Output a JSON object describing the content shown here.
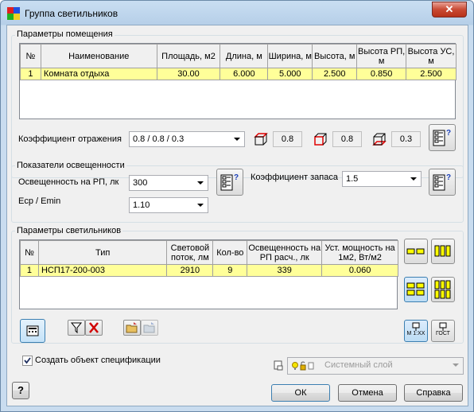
{
  "window": {
    "title": "Группа светильников",
    "close_label": "✕"
  },
  "room_params": {
    "group_label": "Параметры помещения",
    "headers": [
      "№",
      "Наименование",
      "Площадь, м2",
      "Длина, м",
      "Ширина, м",
      "Высота, м",
      "Высота РП, м",
      "Высота УС, м"
    ],
    "rows": [
      [
        "1",
        "Комната отдыха",
        "30.00",
        "6.000",
        "5.000",
        "2.500",
        "0.850",
        "2.500"
      ]
    ],
    "reflection_label": "Коэффициент отражения",
    "reflection_value": "0.8 / 0.8 / 0.3",
    "ceiling_value": "0.8",
    "walls_value": "0.8",
    "floor_value": "0.3"
  },
  "lighting": {
    "group_label": "Показатели освещенности",
    "illuminance_label": "Освещенность на РП, лк",
    "illuminance_value": "300",
    "ecp_label": "Eср / Emin",
    "ecp_value": "1.10",
    "reserve_label": "Коэффициент запаса",
    "reserve_value": "1.5"
  },
  "fixtures": {
    "group_label": "Параметры светильников",
    "headers": [
      "№",
      "Тип",
      "Световой поток, лм",
      "Кол-во",
      "Освещенность на РП расч., лк",
      "Уст. мощность на 1м2, Вт/м2"
    ],
    "rows": [
      [
        "1",
        "НСП17-200-003",
        "2910",
        "9",
        "339",
        "0.060"
      ]
    ],
    "scale_label": "М 1:XX",
    "gost_label": "ГОСТ"
  },
  "footer": {
    "create_spec_label": "Создать объект спецификации",
    "create_spec_checked": true,
    "layer_value": "Системный слой",
    "help_label": "?",
    "ok_label": "ОК",
    "cancel_label": "Отмена",
    "help_button_label": "Справка"
  }
}
